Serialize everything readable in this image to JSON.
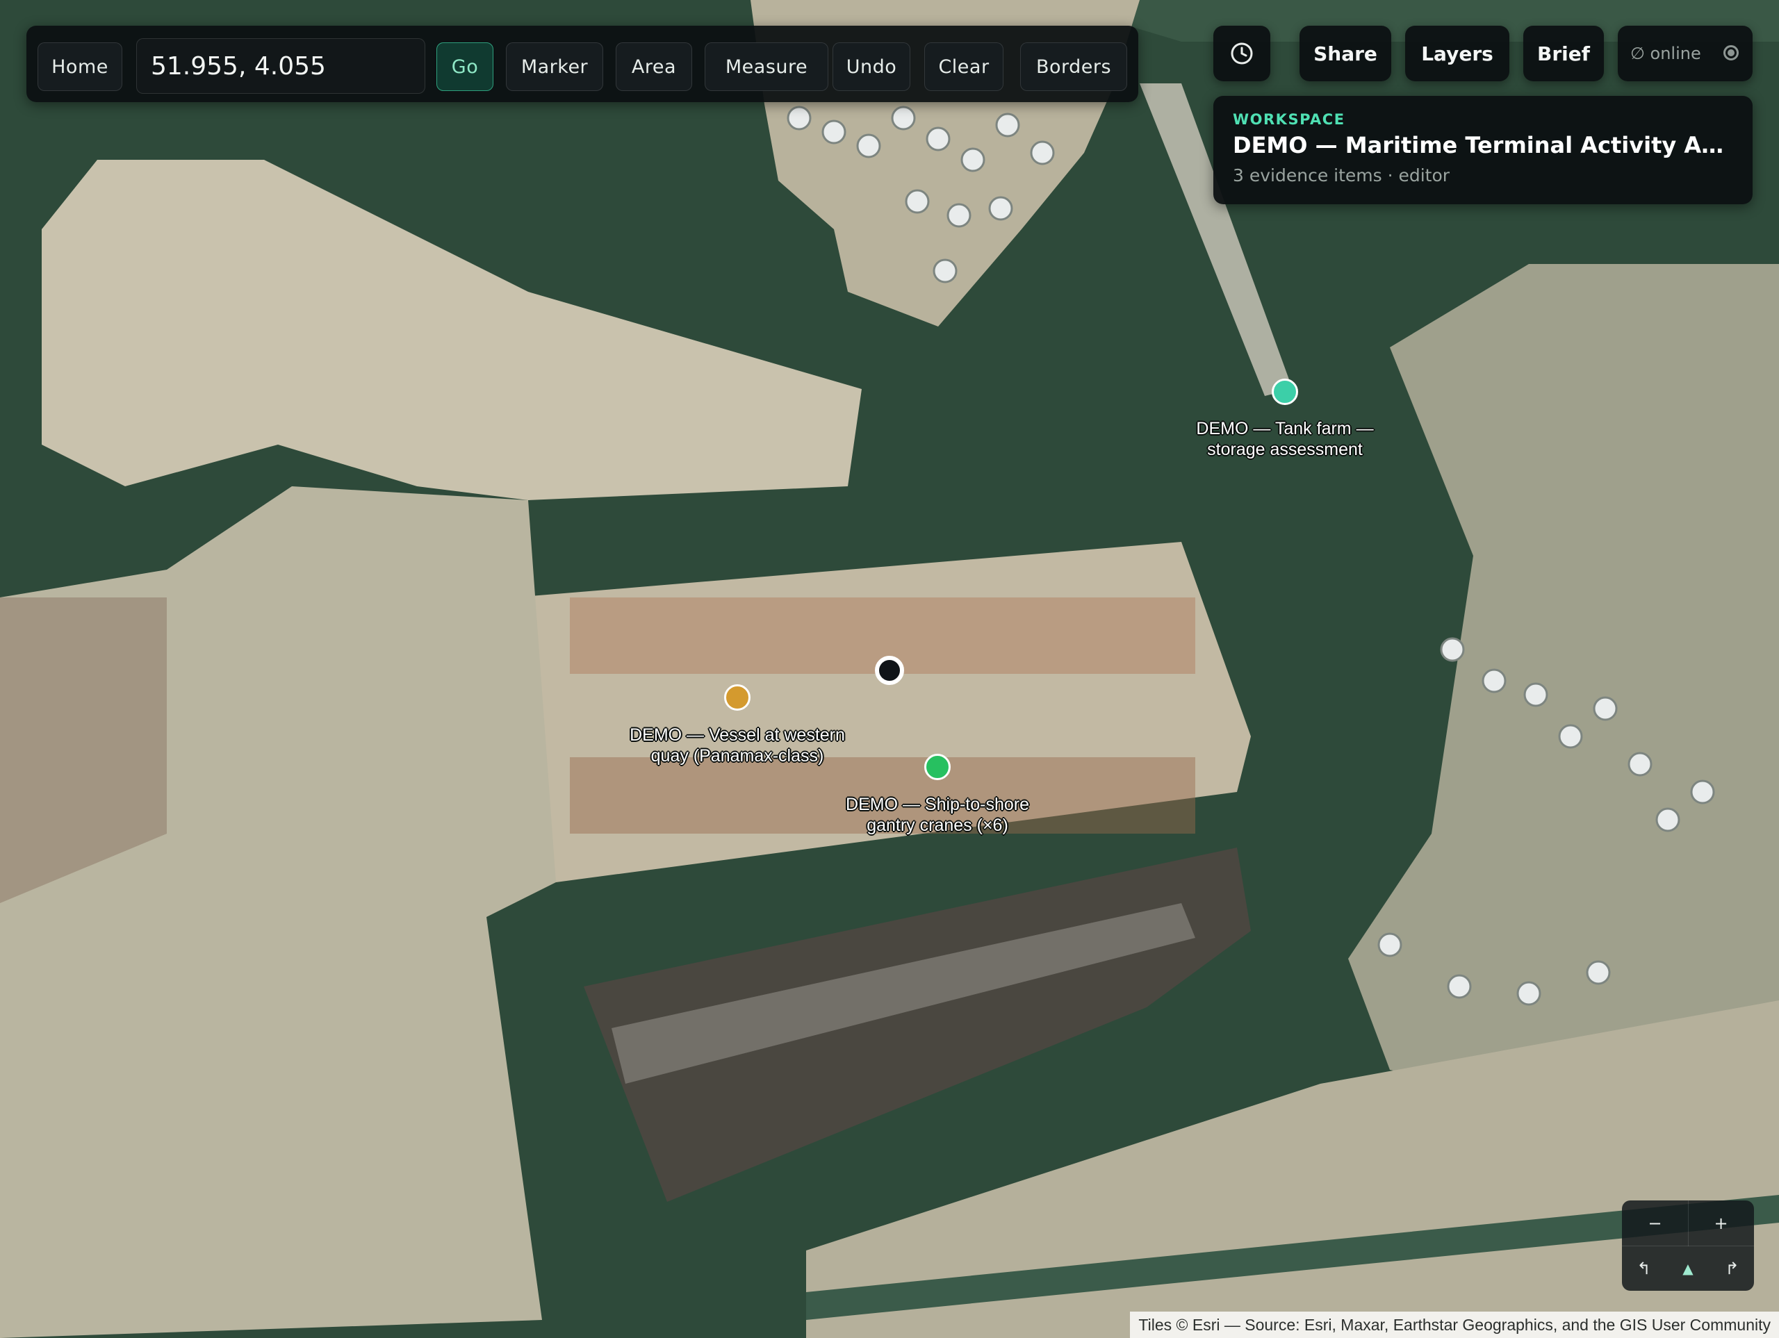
{
  "toolbar": {
    "home_label": "Home",
    "coordinate_value": "51.955, 4.055",
    "go_label": "Go",
    "marker_label": "Marker",
    "area_label": "Area",
    "measure_label": "Measure",
    "undo_label": "Undo",
    "clear_label": "Clear",
    "borders_label": "Borders"
  },
  "top_right": {
    "history_icon": "clock-icon",
    "share_label": "Share",
    "layers_label": "Layers",
    "brief_label": "Brief",
    "status_text": "∅ online",
    "status_icon": "radio-dot-icon"
  },
  "workspace": {
    "kicker": "WORKSPACE",
    "title": "DEMO — Maritime Terminal Activity Assess...",
    "meta": "3 evidence items · editor"
  },
  "markers": [
    {
      "label_line1": "DEMO — Tank farm —",
      "label_line2": "storage assessment",
      "color": "#3ccfa8"
    },
    {
      "label_line1": "DEMO — Vessel at western",
      "label_line2": "quay (Panamax-class)",
      "color": "#d49a2e"
    },
    {
      "label_line1": "DEMO — Ship-to-shore",
      "label_line2": "gantry cranes (×6)",
      "color": "#27c060"
    }
  ],
  "cursor_marker": {
    "color": "#101418"
  },
  "zoom": {
    "minus": "−",
    "plus": "+",
    "rotate_left": "↰",
    "north": "▲",
    "rotate_right": "↱"
  },
  "colors": {
    "water": "#2e4a3a",
    "land": "#c9c2ad",
    "accent": "#4fe0b3"
  },
  "attribution": "Tiles © Esri — Source: Esri, Maxar, Earthstar Geographics, and the GIS User Community"
}
